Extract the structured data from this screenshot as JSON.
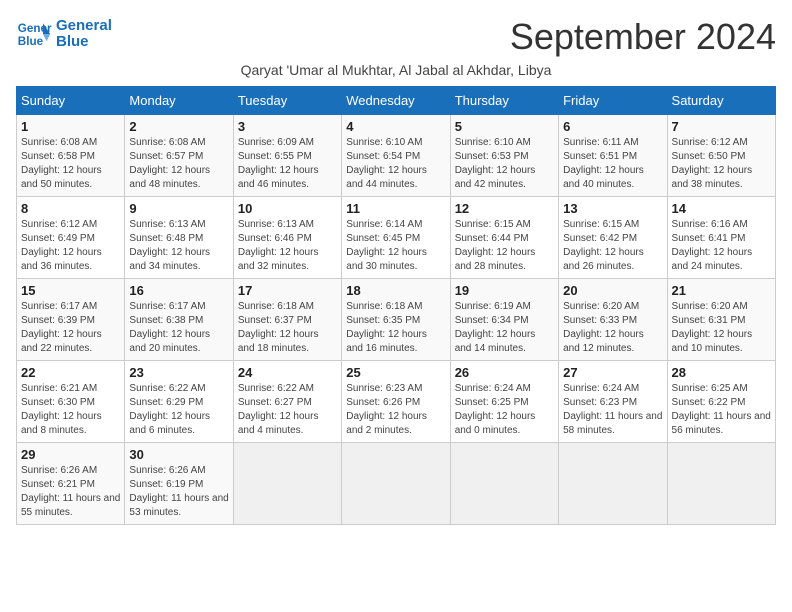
{
  "header": {
    "logo_line1": "General",
    "logo_line2": "Blue",
    "month_title": "September 2024",
    "subtitle": "Qaryat 'Umar al Mukhtar, Al Jabal al Akhdar, Libya"
  },
  "days_of_week": [
    "Sunday",
    "Monday",
    "Tuesday",
    "Wednesday",
    "Thursday",
    "Friday",
    "Saturday"
  ],
  "weeks": [
    [
      {
        "day": "1",
        "sunrise": "6:08 AM",
        "sunset": "6:58 PM",
        "daylight": "12 hours and 50 minutes."
      },
      {
        "day": "2",
        "sunrise": "6:08 AM",
        "sunset": "6:57 PM",
        "daylight": "12 hours and 48 minutes."
      },
      {
        "day": "3",
        "sunrise": "6:09 AM",
        "sunset": "6:55 PM",
        "daylight": "12 hours and 46 minutes."
      },
      {
        "day": "4",
        "sunrise": "6:10 AM",
        "sunset": "6:54 PM",
        "daylight": "12 hours and 44 minutes."
      },
      {
        "day": "5",
        "sunrise": "6:10 AM",
        "sunset": "6:53 PM",
        "daylight": "12 hours and 42 minutes."
      },
      {
        "day": "6",
        "sunrise": "6:11 AM",
        "sunset": "6:51 PM",
        "daylight": "12 hours and 40 minutes."
      },
      {
        "day": "7",
        "sunrise": "6:12 AM",
        "sunset": "6:50 PM",
        "daylight": "12 hours and 38 minutes."
      }
    ],
    [
      {
        "day": "8",
        "sunrise": "6:12 AM",
        "sunset": "6:49 PM",
        "daylight": "12 hours and 36 minutes."
      },
      {
        "day": "9",
        "sunrise": "6:13 AM",
        "sunset": "6:48 PM",
        "daylight": "12 hours and 34 minutes."
      },
      {
        "day": "10",
        "sunrise": "6:13 AM",
        "sunset": "6:46 PM",
        "daylight": "12 hours and 32 minutes."
      },
      {
        "day": "11",
        "sunrise": "6:14 AM",
        "sunset": "6:45 PM",
        "daylight": "12 hours and 30 minutes."
      },
      {
        "day": "12",
        "sunrise": "6:15 AM",
        "sunset": "6:44 PM",
        "daylight": "12 hours and 28 minutes."
      },
      {
        "day": "13",
        "sunrise": "6:15 AM",
        "sunset": "6:42 PM",
        "daylight": "12 hours and 26 minutes."
      },
      {
        "day": "14",
        "sunrise": "6:16 AM",
        "sunset": "6:41 PM",
        "daylight": "12 hours and 24 minutes."
      }
    ],
    [
      {
        "day": "15",
        "sunrise": "6:17 AM",
        "sunset": "6:39 PM",
        "daylight": "12 hours and 22 minutes."
      },
      {
        "day": "16",
        "sunrise": "6:17 AM",
        "sunset": "6:38 PM",
        "daylight": "12 hours and 20 minutes."
      },
      {
        "day": "17",
        "sunrise": "6:18 AM",
        "sunset": "6:37 PM",
        "daylight": "12 hours and 18 minutes."
      },
      {
        "day": "18",
        "sunrise": "6:18 AM",
        "sunset": "6:35 PM",
        "daylight": "12 hours and 16 minutes."
      },
      {
        "day": "19",
        "sunrise": "6:19 AM",
        "sunset": "6:34 PM",
        "daylight": "12 hours and 14 minutes."
      },
      {
        "day": "20",
        "sunrise": "6:20 AM",
        "sunset": "6:33 PM",
        "daylight": "12 hours and 12 minutes."
      },
      {
        "day": "21",
        "sunrise": "6:20 AM",
        "sunset": "6:31 PM",
        "daylight": "12 hours and 10 minutes."
      }
    ],
    [
      {
        "day": "22",
        "sunrise": "6:21 AM",
        "sunset": "6:30 PM",
        "daylight": "12 hours and 8 minutes."
      },
      {
        "day": "23",
        "sunrise": "6:22 AM",
        "sunset": "6:29 PM",
        "daylight": "12 hours and 6 minutes."
      },
      {
        "day": "24",
        "sunrise": "6:22 AM",
        "sunset": "6:27 PM",
        "daylight": "12 hours and 4 minutes."
      },
      {
        "day": "25",
        "sunrise": "6:23 AM",
        "sunset": "6:26 PM",
        "daylight": "12 hours and 2 minutes."
      },
      {
        "day": "26",
        "sunrise": "6:24 AM",
        "sunset": "6:25 PM",
        "daylight": "12 hours and 0 minutes."
      },
      {
        "day": "27",
        "sunrise": "6:24 AM",
        "sunset": "6:23 PM",
        "daylight": "11 hours and 58 minutes."
      },
      {
        "day": "28",
        "sunrise": "6:25 AM",
        "sunset": "6:22 PM",
        "daylight": "11 hours and 56 minutes."
      }
    ],
    [
      {
        "day": "29",
        "sunrise": "6:26 AM",
        "sunset": "6:21 PM",
        "daylight": "11 hours and 55 minutes."
      },
      {
        "day": "30",
        "sunrise": "6:26 AM",
        "sunset": "6:19 PM",
        "daylight": "11 hours and 53 minutes."
      },
      null,
      null,
      null,
      null,
      null
    ]
  ]
}
